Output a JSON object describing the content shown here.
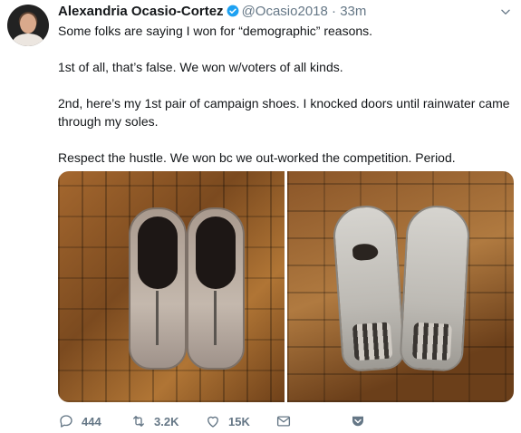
{
  "tweet": {
    "author_name": "Alexandria Ocasio-Cortez",
    "handle": "@Ocasio2018",
    "separator": "·",
    "time": "33m",
    "paragraphs": [
      "Some folks are saying I won for “demographic” reasons.",
      "1st of all, that’s false. We won w/voters of all kinds.",
      "2nd, here’s my 1st pair of campaign shoes. I knocked doors until rainwater came through my soles.",
      "Respect the hustle. We won bc we out-worked the competition. Period."
    ]
  },
  "actions": {
    "reply_count": "444",
    "retweet_count": "3.2K",
    "like_count": "15K"
  },
  "colors": {
    "verified": "#1da1f2",
    "muted": "#657786",
    "text": "#14171a"
  },
  "icons": [
    "verified-badge-icon",
    "chevron-down-icon",
    "reply-icon",
    "retweet-icon",
    "like-icon",
    "envelope-icon"
  ]
}
